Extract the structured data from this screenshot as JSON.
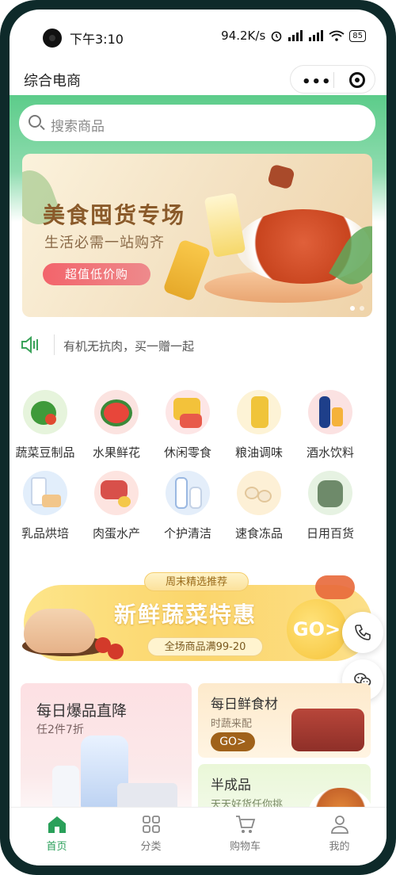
{
  "status_bar": {
    "time": "下午3:10",
    "right": "94.2K/s",
    "battery": "85"
  },
  "nav": {
    "title": "综合电商",
    "menu_glyph": "•••"
  },
  "search": {
    "placeholder": "搜索商品"
  },
  "banner": {
    "title": "美食囤货专场",
    "subtitle": "生活必需一站购齐",
    "button": "超值低价购"
  },
  "notice": {
    "text": "有机无抗肉，买一赠一起"
  },
  "categories": [
    {
      "label": "蔬菜豆制品",
      "icon": "vegetables-icon"
    },
    {
      "label": "水果鲜花",
      "icon": "watermelon-icon"
    },
    {
      "label": "休闲零食",
      "icon": "snacks-icon"
    },
    {
      "label": "粮油调味",
      "icon": "oil-icon"
    },
    {
      "label": "酒水饮料",
      "icon": "drinks-icon"
    },
    {
      "label": "乳品烘培",
      "icon": "dairy-icon"
    },
    {
      "label": "肉蛋水产",
      "icon": "meat-icon"
    },
    {
      "label": "个护清洁",
      "icon": "cleaning-icon"
    },
    {
      "label": "速食冻品",
      "icon": "frozen-food-icon"
    },
    {
      "label": "日用百货",
      "icon": "kettle-icon"
    }
  ],
  "promo": {
    "tag": "周末精选推荐",
    "title": "新鲜蔬菜特惠",
    "subtitle": "全场商品满99-20",
    "go": "GO>"
  },
  "cards": {
    "left": {
      "title": "每日爆品直降",
      "subtitle": "任2件7折"
    },
    "right_top": {
      "title": "每日鲜食材",
      "subtitle": "时蔬来配",
      "button": "GO>"
    },
    "right_bottom": {
      "title": "半成品",
      "subtitle": "天天好货任你挑"
    }
  },
  "tabbar": [
    {
      "label": "首页",
      "icon": "home-icon",
      "active": true
    },
    {
      "label": "分类",
      "icon": "category-icon",
      "active": false
    },
    {
      "label": "购物车",
      "icon": "cart-icon",
      "active": false
    },
    {
      "label": "我的",
      "icon": "user-icon",
      "active": false
    }
  ],
  "colors": {
    "brand_green": "#5ccc8a",
    "active_tab": "#2aa05a",
    "banner_button": "#f2646b",
    "promo_yellow": "#fbd56b"
  }
}
